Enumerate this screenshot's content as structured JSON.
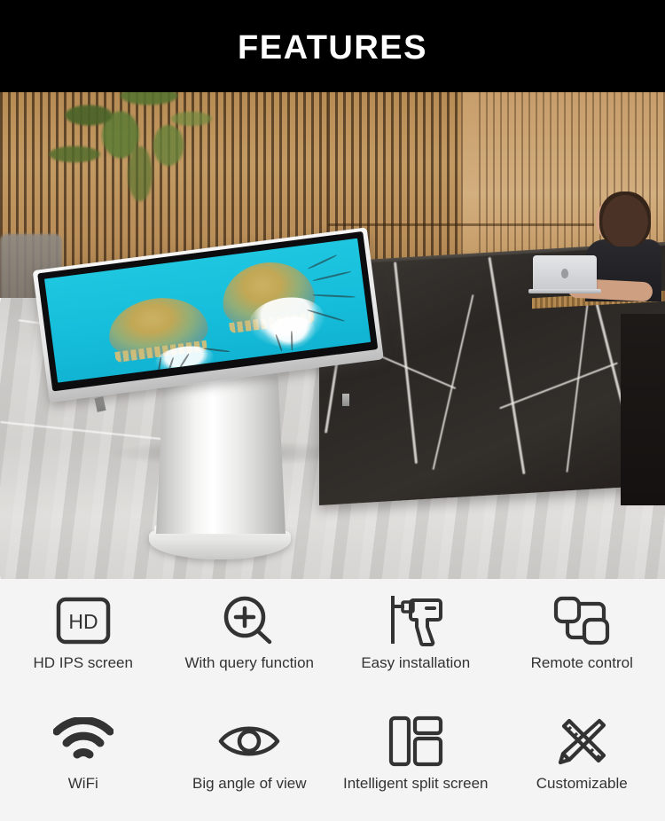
{
  "header": {
    "title": "FEATURES",
    "background_color": "#000000",
    "text_color": "#ffffff"
  },
  "hero": {
    "name": "interactive-touch-kiosk-in-lobby",
    "screen_content": "jellyfish-on-cyan-background",
    "setting": "reception-lobby-with-marble-counter",
    "screen_background_color": "#16bedb",
    "kiosk_body_color": "#e6e6e5",
    "floor_color": "#d2d0cd",
    "counter_color": "#2b2724",
    "wall_color": "#c49a63"
  },
  "features": {
    "background_color": "#f4f4f4",
    "label_color": "#333333",
    "rows": [
      [
        {
          "icon": "hd-icon",
          "label": "HD IPS screen"
        },
        {
          "icon": "magnifier-plus-icon",
          "label": "With query function"
        },
        {
          "icon": "drill-icon",
          "label": "Easy installation"
        },
        {
          "icon": "remote-control-icon",
          "label": "Remote control"
        }
      ],
      [
        {
          "icon": "wifi-icon",
          "label": "WiFi"
        },
        {
          "icon": "eye-icon",
          "label": "Big angle of view"
        },
        {
          "icon": "split-screen-icon",
          "label": "Intelligent split screen"
        },
        {
          "icon": "ruler-pencil-icon",
          "label": "Customizable"
        }
      ]
    ]
  }
}
